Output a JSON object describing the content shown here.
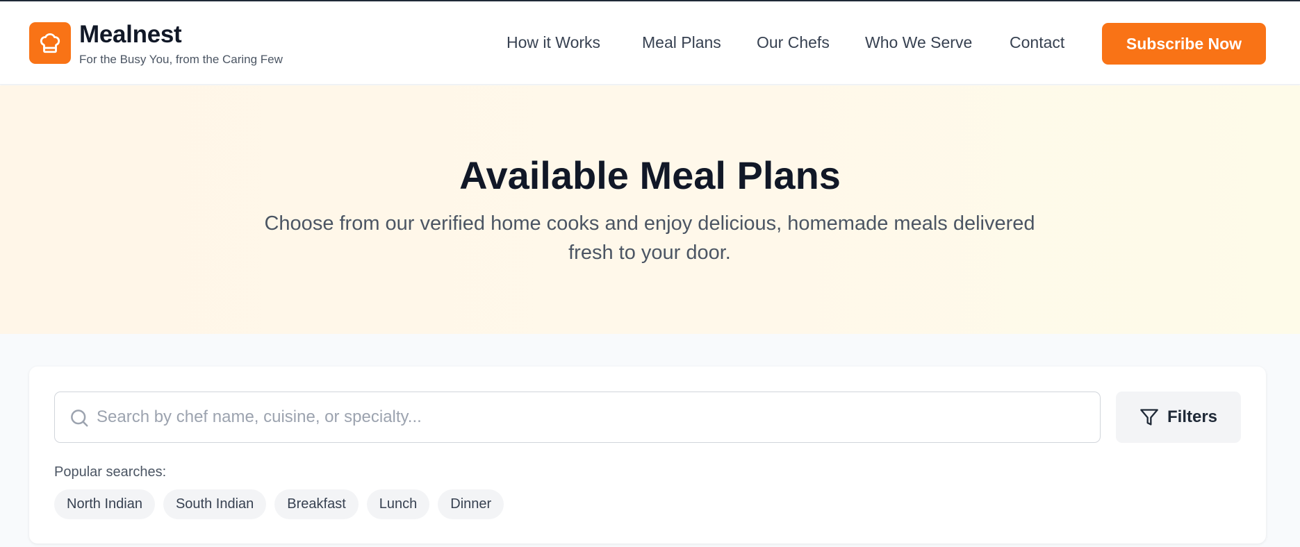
{
  "brand": {
    "name": "Mealnest",
    "tagline": "For the Busy You, from the Caring Few",
    "logo_icon": "chef-hat-icon"
  },
  "nav": {
    "links": [
      "How it Works",
      "Meal Plans",
      "Our Chefs",
      "Who We Serve",
      "Contact"
    ],
    "cta_label": "Subscribe Now"
  },
  "hero": {
    "title": "Available Meal Plans",
    "subtitle": "Choose from our verified home cooks and enjoy delicious, homemade meals delivered fresh to your door."
  },
  "search": {
    "placeholder": "Search by chef name, cuisine, or specialty...",
    "value": "",
    "icon": "search-icon",
    "filters_label": "Filters",
    "filters_icon": "funnel-icon",
    "popular_label": "Popular searches:",
    "popular_chips": [
      "North Indian",
      "South Indian",
      "Breakfast",
      "Lunch",
      "Dinner"
    ]
  },
  "colors": {
    "accent": "#f97316",
    "hero_bg": "#fff6e8",
    "page_bg": "#f8fafc"
  }
}
